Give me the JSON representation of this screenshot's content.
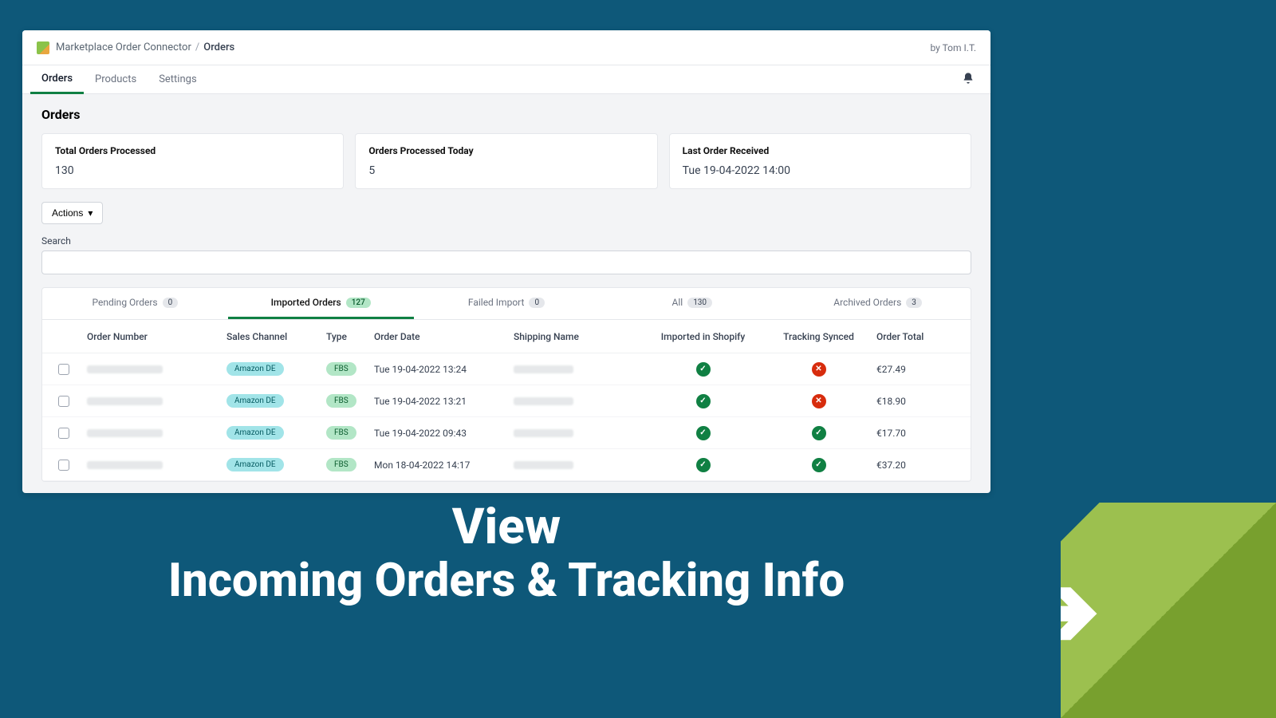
{
  "header": {
    "app": "Marketplace Order Connector",
    "page": "Orders",
    "byline": "by Tom I.T."
  },
  "nav": {
    "tabs": [
      "Orders",
      "Products",
      "Settings"
    ],
    "active": 0
  },
  "page_title": "Orders",
  "stats": {
    "total_label": "Total Orders Processed",
    "total_value": "130",
    "today_label": "Orders Processed Today",
    "today_value": "5",
    "last_label": "Last Order Received",
    "last_value": "Tue 19-04-2022 14:00"
  },
  "actions_label": "Actions",
  "search_label": "Search",
  "table_tabs": [
    {
      "label": "Pending Orders",
      "count": "0",
      "active": false
    },
    {
      "label": "Imported Orders",
      "count": "127",
      "active": true
    },
    {
      "label": "Failed Import",
      "count": "0",
      "active": false
    },
    {
      "label": "All",
      "count": "130",
      "active": false
    },
    {
      "label": "Archived Orders",
      "count": "3",
      "active": false
    }
  ],
  "columns": [
    "Order Number",
    "Sales Channel",
    "Type",
    "Order Date",
    "Shipping Name",
    "Imported in Shopify",
    "Tracking Synced",
    "Order Total"
  ],
  "rows": [
    {
      "channel": "Amazon DE",
      "type": "FBS",
      "date": "Tue 19-04-2022 13:24",
      "imported": true,
      "tracking": false,
      "total": "€27.49"
    },
    {
      "channel": "Amazon DE",
      "type": "FBS",
      "date": "Tue 19-04-2022 13:21",
      "imported": true,
      "tracking": false,
      "total": "€18.90"
    },
    {
      "channel": "Amazon DE",
      "type": "FBS",
      "date": "Tue 19-04-2022 09:43",
      "imported": true,
      "tracking": true,
      "total": "€17.70"
    },
    {
      "channel": "Amazon DE",
      "type": "FBS",
      "date": "Mon 18-04-2022 14:17",
      "imported": true,
      "tracking": true,
      "total": "€37.20"
    }
  ],
  "promo": {
    "line1": "View",
    "line2": "Incoming Orders & Tracking Info"
  }
}
